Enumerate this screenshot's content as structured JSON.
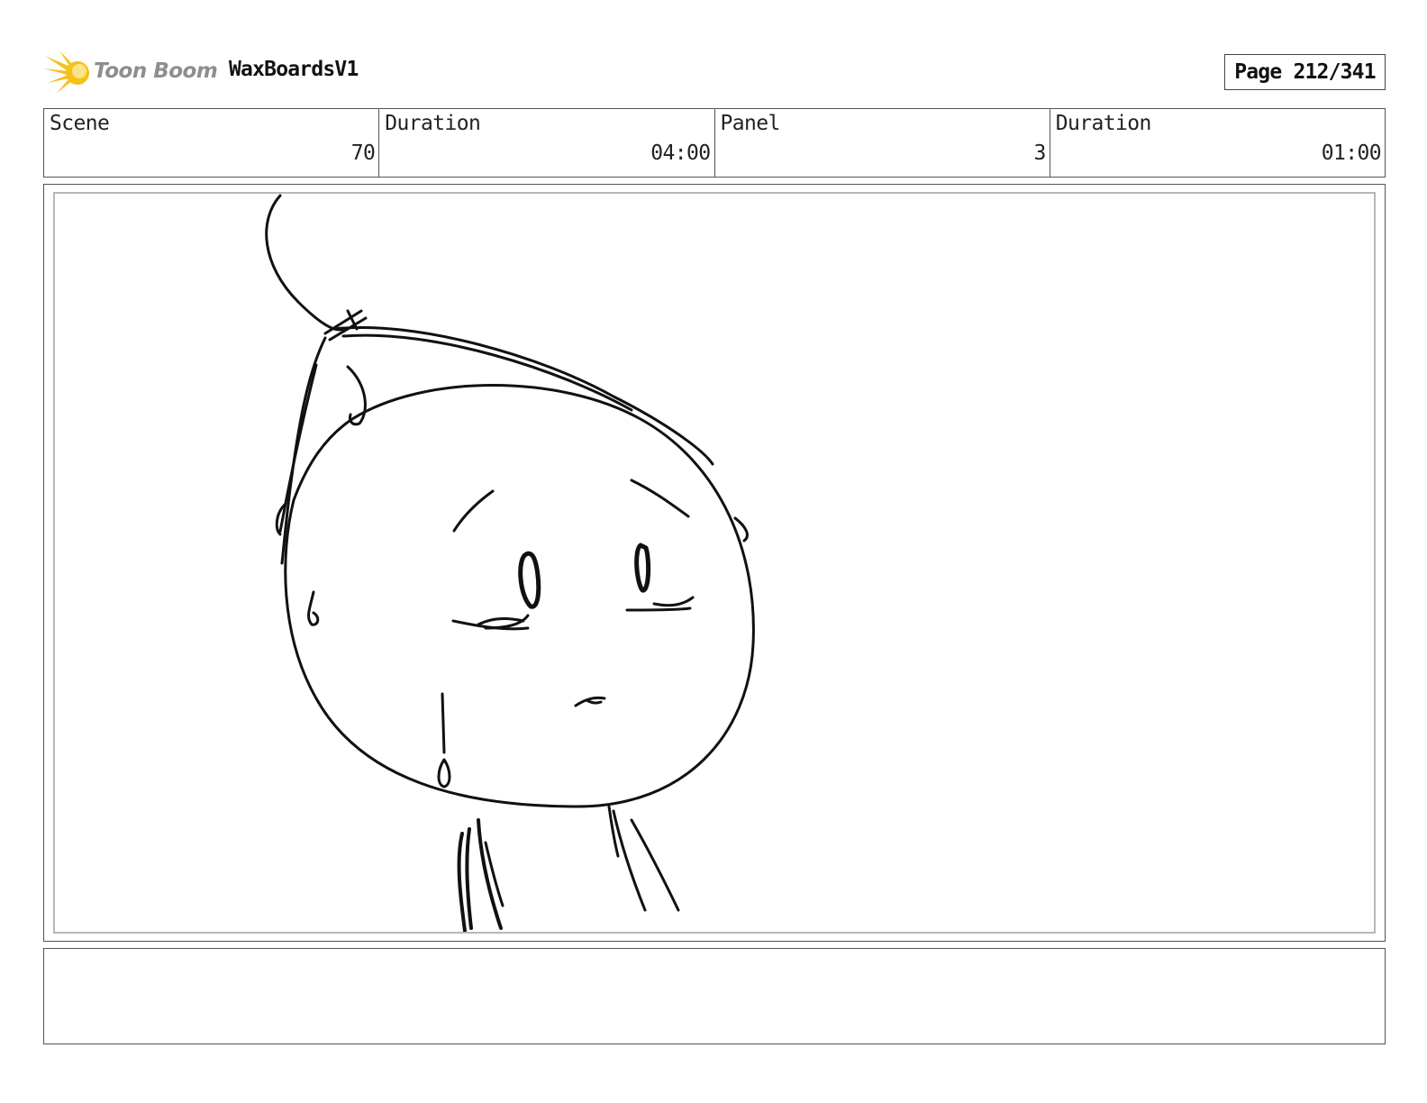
{
  "header": {
    "logo_text": "Toon Boom",
    "project_title": "WaxBoardsV1",
    "page_label": "Page 212/341"
  },
  "info": {
    "scene": {
      "label": "Scene",
      "value": "70"
    },
    "scene_duration": {
      "label": "Duration",
      "value": "04:00"
    },
    "panel": {
      "label": "Panel",
      "value": "3"
    },
    "panel_duration": {
      "label": "Duration",
      "value": "01:00"
    }
  },
  "notes": {
    "text": ""
  },
  "colors": {
    "logo_star": "#f5c11a",
    "logo_text": "#8e8e8e",
    "border": "#555555",
    "panel_inner_border": "#b8b8b8"
  }
}
